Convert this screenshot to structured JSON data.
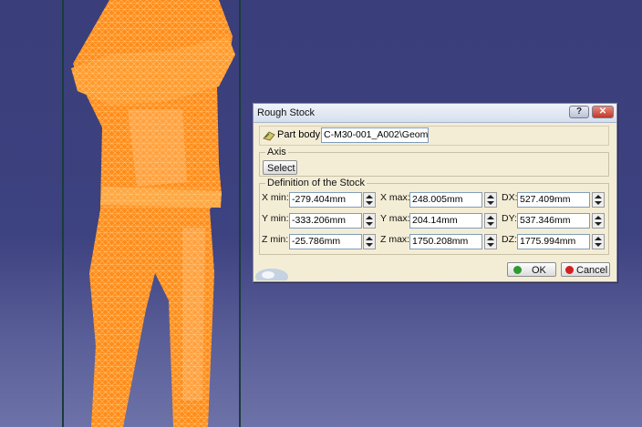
{
  "dialog": {
    "title": "Rough Stock",
    "help_label": "?",
    "close_label": "✕",
    "part_body": {
      "label": "Part body:",
      "value": "C-M30-001_A002\\Geome"
    },
    "axis": {
      "legend": "Axis",
      "select_label": "Select"
    },
    "definition": {
      "legend": "Definition of the Stock",
      "x_min": {
        "label": "X min:",
        "value": "-279.404mm"
      },
      "y_min": {
        "label": "Y min:",
        "value": "-333.206mm"
      },
      "z_min": {
        "label": "Z min:",
        "value": "-25.786mm"
      },
      "x_max": {
        "label": "X max:",
        "value": "248.005mm"
      },
      "y_max": {
        "label": "Y max:",
        "value": "204.14mm"
      },
      "z_max": {
        "label": "Z max:",
        "value": "1750.208mm"
      },
      "dx": {
        "label": "DX:",
        "value": "527.409mm"
      },
      "dy": {
        "label": "DY:",
        "value": "537.346mm"
      },
      "dz": {
        "label": "DZ:",
        "value": "1775.994mm"
      }
    },
    "ok_label": "OK",
    "cancel_label": "Cancel"
  },
  "colors": {
    "background": "#3d4280",
    "model": "#ff8c1a",
    "ok_icon": "#2e9b2e",
    "cancel_icon": "#d02020"
  },
  "icons": [
    "part-body-icon",
    "ok-check-icon",
    "cancel-icon",
    "compass-icon"
  ]
}
